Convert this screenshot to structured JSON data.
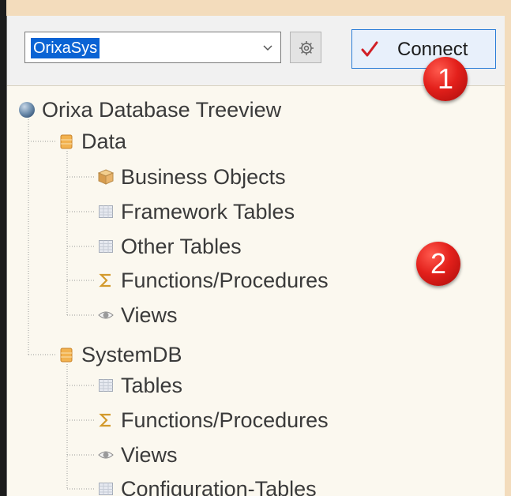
{
  "toolbar": {
    "database_value": "OrixaSys",
    "connect_label": "Connect"
  },
  "badges": {
    "first": "1",
    "second": "2"
  },
  "tree": {
    "root": "Orixa Database Treeview",
    "data": {
      "label": "Data",
      "children": [
        "Business Objects",
        "Framework Tables",
        "Other Tables",
        "Functions/Procedures",
        "Views"
      ]
    },
    "systemdb": {
      "label": "SystemDB",
      "children": [
        "Tables",
        "Functions/Procedures",
        "Views",
        "Configuration-Tables"
      ]
    }
  },
  "colors": {
    "selection": "#0a63d4",
    "accent_border": "#2b7dd7",
    "check": "#d11f26",
    "badge": "#e3201b",
    "tree_background": "#fbf8ef",
    "outer_background": "#f3dcbc"
  },
  "icons": {
    "root": "globe-icon",
    "database": "database-icon",
    "business_objects": "cube-icon",
    "table": "table-icon",
    "function": "sigma-icon",
    "view": "eye-icon",
    "settings": "gear-icon",
    "connect": "checkmark-icon",
    "dropdown": "chevron-down-icon"
  }
}
